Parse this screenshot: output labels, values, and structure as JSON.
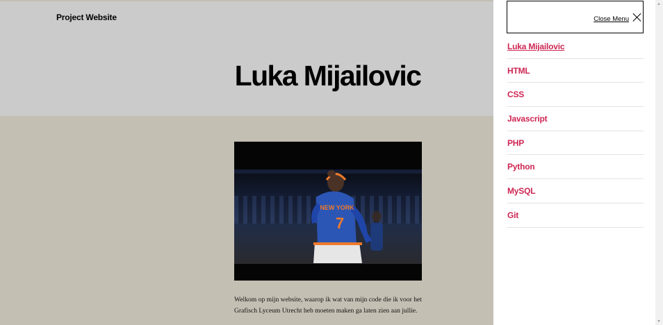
{
  "header": {
    "site_title": "Project Website"
  },
  "page": {
    "title": "Luka Mijailovic",
    "intro_text": "Welkom op mijn website, waarop ik wat van mijn code die ik voor het Grafisch Lyceum Utrecht heb moeten maken ga laten zien aan jullie."
  },
  "hero_image": {
    "jersey_text": "NEW YORK",
    "jersey_number": "7"
  },
  "menu": {
    "close_label": "Close Menu",
    "items": [
      {
        "label": "Luka Mijailovic",
        "current": true
      },
      {
        "label": "HTML"
      },
      {
        "label": "CSS"
      },
      {
        "label": "Javascript"
      },
      {
        "label": "PHP"
      },
      {
        "label": "Python"
      },
      {
        "label": "MySQL"
      },
      {
        "label": "Git"
      }
    ]
  },
  "colors": {
    "accent": "#cd2653",
    "header_bg": "#cbcbcb",
    "body_bg": "#c4bfb3"
  },
  "icons": {
    "close": "close-icon",
    "scroll_up": "scroll-up-arrow-icon",
    "scroll_down": "scroll-down-arrow-icon"
  }
}
